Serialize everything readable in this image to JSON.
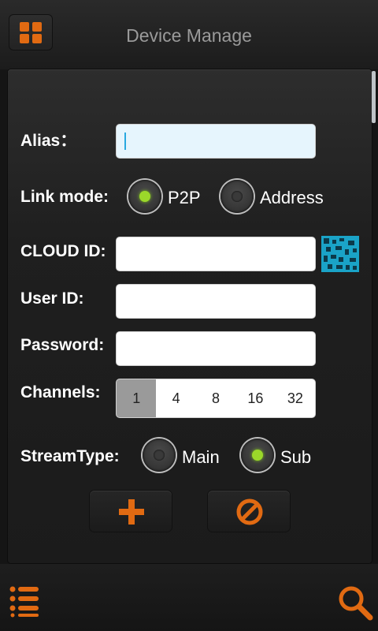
{
  "header": {
    "title": "Device Manage",
    "menu_icon": "grid-menu-icon"
  },
  "form": {
    "alias_label": "Alias：",
    "alias_value": "",
    "link_mode_label": "Link mode:",
    "link_mode_options": [
      "P2P",
      "Address"
    ],
    "link_mode_selected": "P2P",
    "cloud_id_label": "CLOUD ID:",
    "cloud_id_value": "",
    "qr_icon": "qr-code-icon",
    "user_id_label": "User ID:",
    "user_id_value": "",
    "password_label": "Password:",
    "password_value": "",
    "channels_label": "Channels:",
    "channels_options": [
      "1",
      "4",
      "8",
      "16",
      "32"
    ],
    "channels_selected": "1",
    "stream_type_label": "StreamType:",
    "stream_type_options": [
      "Main",
      "Sub"
    ],
    "stream_type_selected": "Sub"
  },
  "actions": {
    "add_icon": "plus-icon",
    "cancel_icon": "cancel-icon"
  },
  "bottom_bar": {
    "list_icon": "list-icon",
    "search_icon": "search-icon"
  },
  "colors": {
    "accent": "#e16a12",
    "radio_on": "#9bd82a",
    "qr": "#1e90b0",
    "background": "#151515"
  }
}
